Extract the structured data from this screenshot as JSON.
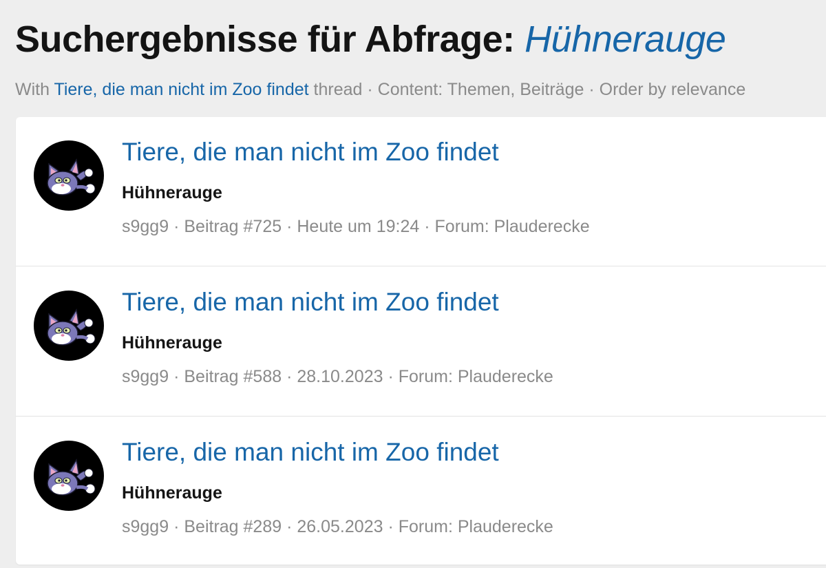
{
  "header": {
    "title_prefix": "Suchergebnisse für Abfrage:",
    "query": "Hühnerauge"
  },
  "filter": {
    "with_label": "With",
    "thread_link": "Tiere, die man nicht im Zoo findet",
    "thread_label": "thread",
    "sep1": "·",
    "content_text": "Content: Themen, Beiträge",
    "sep2": "·",
    "order_text": "Order by relevance"
  },
  "results": [
    {
      "avatar_icon": "cat-avatar-icon",
      "title": "Tiere, die man nicht im Zoo findet",
      "snippet": "Hühnerauge",
      "author": "s9gg9",
      "post": "Beitrag #725",
      "date": "Heute um 19:24",
      "forum": "Forum: Plauderecke",
      "sep": "·"
    },
    {
      "avatar_icon": "cat-avatar-icon",
      "title": "Tiere, die man nicht im Zoo findet",
      "snippet": "Hühnerauge",
      "author": "s9gg9",
      "post": "Beitrag #588",
      "date": "28.10.2023",
      "forum": "Forum: Plauderecke",
      "sep": "·"
    },
    {
      "avatar_icon": "cat-avatar-icon",
      "title": "Tiere, die man nicht im Zoo findet",
      "snippet": "Hühnerauge",
      "author": "s9gg9",
      "post": "Beitrag #289",
      "date": "26.05.2023",
      "forum": "Forum: Plauderecke",
      "sep": "·"
    }
  ],
  "colors": {
    "link": "#1766a8",
    "heading": "#141414",
    "muted": "#8a8a8a",
    "page_bg": "#eeeeee",
    "card_bg": "#ffffff"
  }
}
